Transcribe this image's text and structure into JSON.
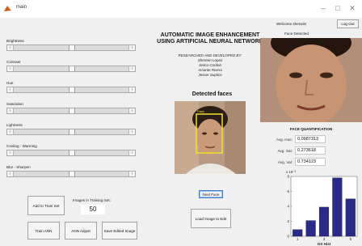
{
  "window": {
    "title": "main"
  },
  "sliders": [
    {
      "label": "Brightness"
    },
    {
      "label": "Contrast"
    },
    {
      "label": "Hue"
    },
    {
      "label": "Saturation"
    },
    {
      "label": "Lightness"
    },
    {
      "label": "Cooling - Warming"
    },
    {
      "label": "Blur - Sharpen"
    }
  ],
  "training": {
    "add_label": "Add to Train Set",
    "count_label": "Images in Training Set:",
    "count_value": "50",
    "train_label": "Train ANN",
    "adjust_label": "ANN Adjust",
    "save_label": "Save Edited Image"
  },
  "header": {
    "title_line1": "AUTOMATIC IMAGE ENHANCEMENT",
    "title_line2": "USING ARTIFICIAL NEURAL NETWORK",
    "credits_heading": "RESEARCHED AND DEVELOPED BY:",
    "authors": [
      "Shereen Lopez",
      "Jerico Cordon",
      "Amante Rivera",
      "Jesser Suplico"
    ]
  },
  "detection": {
    "title": "Detected faces",
    "face_tag": "Face",
    "next_face_label": "Next Face",
    "load_label": "Load Image to Edit"
  },
  "user": {
    "welcome": "Welcome sherwin!",
    "logout_label": "Log Out",
    "face_detected": "Face Detected"
  },
  "quantification": {
    "title": "FACE QUANTIFICATION",
    "rows": [
      {
        "label": "Avg. Hue:",
        "value": "0.0987313"
      },
      {
        "label": "Avg. Sat:",
        "value": "0.273618"
      },
      {
        "label": "Avg. Val:",
        "value": "0.734123"
      }
    ]
  },
  "chart_data": {
    "type": "bar",
    "title": "",
    "xlabel": "GS Hist",
    "ylabel": "",
    "exponent_label": "x 10⁻³",
    "categories": [
      "1",
      "2",
      "3",
      "4",
      "5"
    ],
    "values": [
      0.9,
      2.1,
      3.9,
      7.8,
      5.0
    ],
    "ylim": [
      0,
      8
    ],
    "yticks": [
      "0",
      "2",
      "4",
      "6",
      "8"
    ],
    "xticks": [
      "1",
      "",
      "3",
      "",
      "5"
    ],
    "bar_color": "#2a2a8c"
  }
}
